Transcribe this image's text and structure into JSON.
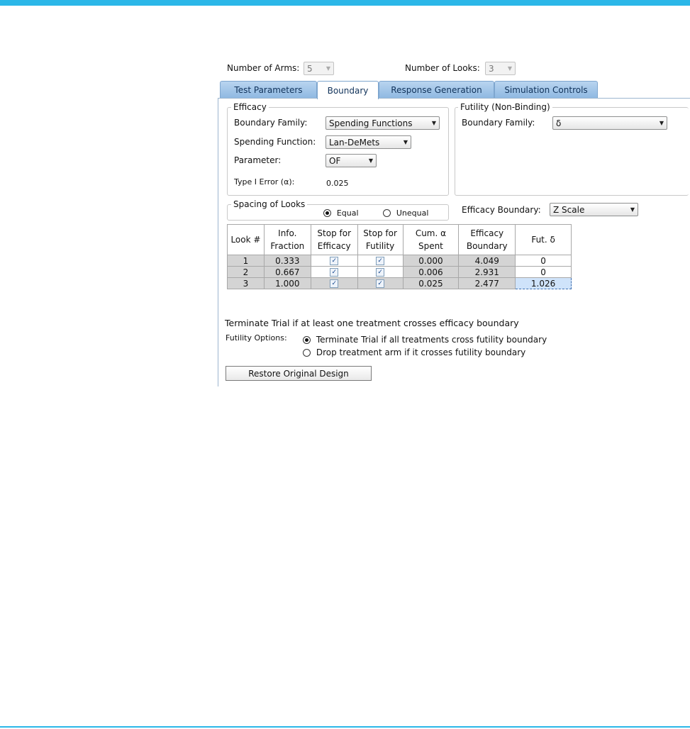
{
  "top": {
    "arms_label": "Number of Arms:",
    "arms_value": "5",
    "looks_label": "Number of Looks:",
    "looks_value": "3"
  },
  "tabs": [
    "Test Parameters",
    "Boundary",
    "Response Generation",
    "Simulation Controls"
  ],
  "efficacy": {
    "legend": "Efficacy",
    "family_label": "Boundary Family:",
    "family_value": "Spending Functions",
    "spending_label": "Spending Function:",
    "spending_value": "Lan-DeMets",
    "parameter_label": "Parameter:",
    "parameter_value": "OF",
    "alpha_label": "Type I Error (α):",
    "alpha_value": "0.025"
  },
  "futility": {
    "legend": "Futility (Non-Binding)",
    "family_label": "Boundary Family:",
    "family_value": "δ"
  },
  "spacing": {
    "legend": "Spacing of Looks",
    "equal_label": "Equal",
    "unequal_label": "Unequal",
    "selected": "Equal"
  },
  "efficacy_boundary": {
    "label": "Efficacy Boundary:",
    "value": "Z Scale"
  },
  "table": {
    "headers": [
      [
        "Look #"
      ],
      [
        "Info.",
        "Fraction"
      ],
      [
        "Stop for",
        "Efficacy"
      ],
      [
        "Stop for",
        "Futility"
      ],
      [
        "Cum. α",
        "Spent"
      ],
      [
        "Efficacy",
        "Boundary"
      ],
      [
        "Fut. δ"
      ]
    ],
    "rows": [
      {
        "look": "1",
        "info": "0.333",
        "stop_eff": true,
        "stop_fut": true,
        "cum_alpha": "0.000",
        "eff_boundary": "4.049",
        "fut_delta": "0"
      },
      {
        "look": "2",
        "info": "0.667",
        "stop_eff": true,
        "stop_fut": true,
        "cum_alpha": "0.006",
        "eff_boundary": "2.931",
        "fut_delta": "0"
      },
      {
        "look": "3",
        "info": "1.000",
        "stop_eff": true,
        "stop_fut": true,
        "cum_alpha": "0.025",
        "eff_boundary": "2.477",
        "fut_delta": "1.026"
      }
    ]
  },
  "terminate_text": "Terminate Trial if at least one treatment crosses efficacy boundary",
  "futility_options": {
    "label": "Futility Options:",
    "option1": "Terminate Trial if all treatments cross futility boundary",
    "option2": "Drop treatment arm if it crosses futility boundary",
    "selected": 1
  },
  "restore_button": "Restore Original Design",
  "colors": {
    "accent_bar": "#2bb7e8",
    "tab_blue": "#8fb9e2",
    "grid_gray": "#d4d4d4",
    "selection": "#cfe3fa"
  }
}
